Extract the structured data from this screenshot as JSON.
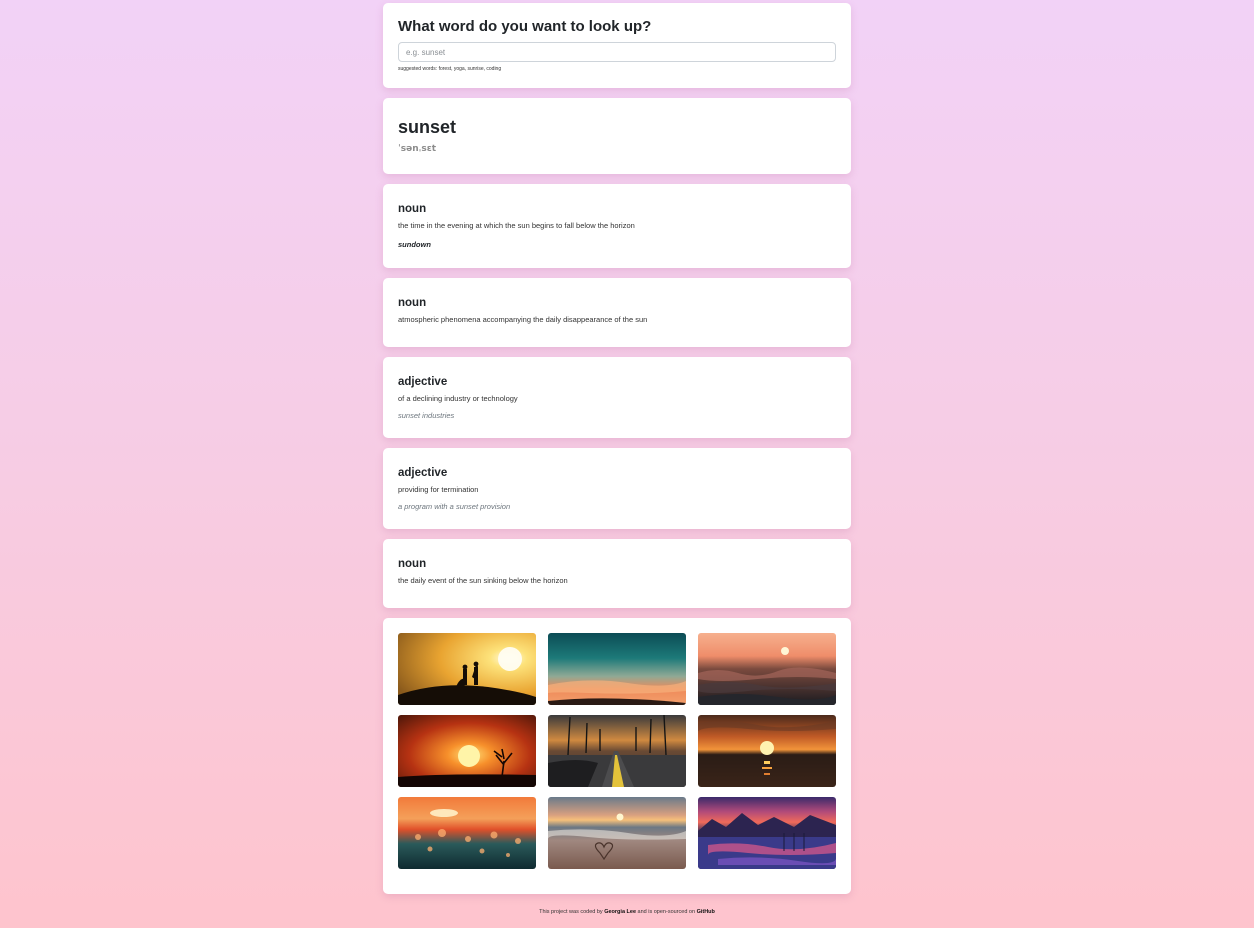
{
  "search": {
    "heading": "What word do you want to look up?",
    "placeholder": "e.g. sunset",
    "value": "",
    "suggested": "suggested words: forest, yoga, sunrise, coding"
  },
  "word": {
    "title": "sunset",
    "phonetic": "ˈsənˌsɛt"
  },
  "meanings": [
    {
      "part_of_speech": "noun",
      "definition": "the time in the evening at which the sun begins to fall below the horizon",
      "example": "",
      "synonym": "sundown"
    },
    {
      "part_of_speech": "noun",
      "definition": "atmospheric phenomena accompanying the daily disappearance of the sun",
      "example": "",
      "synonym": ""
    },
    {
      "part_of_speech": "adjective",
      "definition": "of a declining industry or technology",
      "example": "sunset industries",
      "synonym": ""
    },
    {
      "part_of_speech": "adjective",
      "definition": "providing for termination",
      "example": "a program with a sunset provision",
      "synonym": ""
    },
    {
      "part_of_speech": "noun",
      "definition": "the daily event of the sun sinking below the horizon",
      "example": "",
      "synonym": ""
    }
  ],
  "photos": [
    "couple-silhouette-sunset-photo",
    "teal-sky-sunset-photo",
    "ocean-waves-sunset-photo",
    "tree-silhouette-sunset-photo",
    "palm-road-sunset-photo",
    "lake-sunset-photo",
    "bokeh-sea-sunset-photo",
    "beach-heart-sunset-photo",
    "mountain-lake-sunset-photo"
  ],
  "footer": {
    "prefix": "This project was coded by",
    "author": "Georgia Lee",
    "middle": "and is open-sourced on",
    "link": "GitHub"
  }
}
